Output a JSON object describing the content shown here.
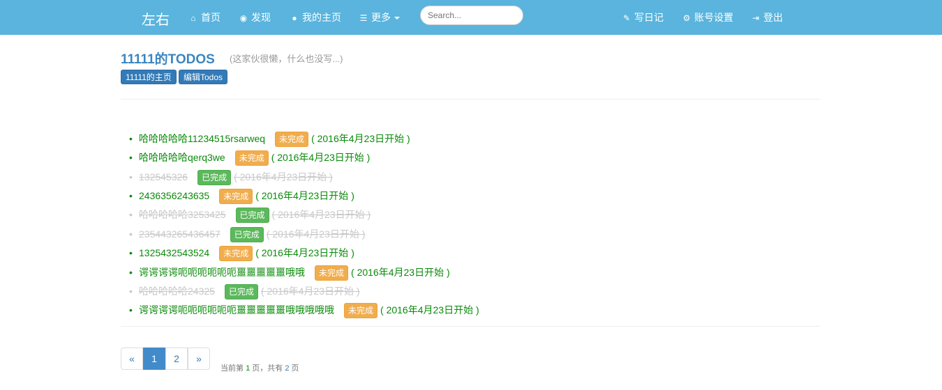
{
  "nav": {
    "brand": "左右",
    "items": [
      {
        "icon": "home-icon",
        "glyph": "⌂",
        "label": "首页"
      },
      {
        "icon": "eye-icon",
        "glyph": "◉",
        "label": "发现"
      },
      {
        "icon": "user-icon",
        "glyph": "●",
        "label": "我的主页"
      },
      {
        "icon": "list-icon",
        "glyph": "☰",
        "label": "更多"
      }
    ],
    "search_placeholder": "Search...",
    "right_items": [
      {
        "icon": "pencil-icon",
        "glyph": "✎",
        "label": "写日记"
      },
      {
        "icon": "gear-icon",
        "glyph": "⚙",
        "label": "账号设置"
      },
      {
        "icon": "logout-icon",
        "glyph": "⇥",
        "label": "登出"
      }
    ]
  },
  "header": {
    "title": "11111的TODOS",
    "subtitle": "(这家伙很懒，什么也没写...)",
    "home_button": "11111的主页",
    "edit_button": "编辑Todos"
  },
  "todos": [
    {
      "text": "哈哈哈哈哈11234515rsarweq",
      "status": "未完成",
      "done": false,
      "date": "( 2016年4月23日开始 )"
    },
    {
      "text": "哈哈哈哈哈qerq3we",
      "status": "未完成",
      "done": false,
      "date": "( 2016年4月23日开始 )"
    },
    {
      "text": "132545326",
      "status": "已完成",
      "done": true,
      "date": "( 2016年4月23日开始 )"
    },
    {
      "text": "2436356243635",
      "status": "未完成",
      "done": false,
      "date": "( 2016年4月23日开始 )"
    },
    {
      "text": "哈哈哈哈哈3253425",
      "status": "已完成",
      "done": true,
      "date": "( 2016年4月23日开始 )"
    },
    {
      "text": "235443265436457",
      "status": "已完成",
      "done": true,
      "date": "( 2016年4月23日开始 )"
    },
    {
      "text": "1325432543524",
      "status": "未完成",
      "done": false,
      "date": "( 2016年4月23日开始 )"
    },
    {
      "text": "谔谔谔谔呃呃呃呃呃呃噩噩噩噩噩哦哦",
      "status": "未完成",
      "done": false,
      "date": "( 2016年4月23日开始 )"
    },
    {
      "text": "哈哈哈哈哈24325",
      "status": "已完成",
      "done": true,
      "date": "( 2016年4月23日开始 )"
    },
    {
      "text": "谔谔谔谔呃呃呃呃呃呃噩噩噩噩噩哦哦哦哦哦",
      "status": "未完成",
      "done": false,
      "date": "( 2016年4月23日开始 )"
    }
  ],
  "pagination": {
    "prev": "«",
    "pages": [
      "1",
      "2"
    ],
    "next": "»",
    "current_page": 1,
    "info_prefix": "当前第 ",
    "info_current": "1",
    "info_mid": " 页，共有 ",
    "info_total": "2",
    "info_suffix": " 页"
  },
  "colors": {
    "navbar": "#5ab4dd",
    "title": "#3a86c0",
    "pending_text": "#0a8a0a",
    "done_text": "#c8c8c8",
    "warning_badge": "#f0ad4e",
    "success_badge": "#5cb85c",
    "primary_button": "#337ab7"
  }
}
